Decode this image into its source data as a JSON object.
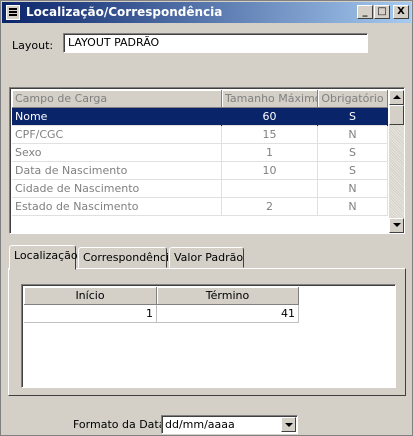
{
  "window": {
    "title": "Localização/Correspondência",
    "minimize": "_",
    "maximize": "□",
    "close": "X"
  },
  "layout": {
    "label": "Layout:",
    "value": "LAYOUT PADRÃO"
  },
  "grid": {
    "columns": [
      "Campo de Carga",
      "Tamanho Máximo",
      "Obrigatório"
    ],
    "rows": [
      {
        "campo": "Nome",
        "tamanho": "60",
        "obrigatorio": "S"
      },
      {
        "campo": "CPF/CGC",
        "tamanho": "15",
        "obrigatorio": "N"
      },
      {
        "campo": "Sexo",
        "tamanho": "1",
        "obrigatorio": "S"
      },
      {
        "campo": "Data de Nascimento",
        "tamanho": "10",
        "obrigatorio": "S"
      },
      {
        "campo": "Cidade de Nascimento",
        "tamanho": "",
        "obrigatorio": "N"
      },
      {
        "campo": "Estado de Nascimento",
        "tamanho": "2",
        "obrigatorio": "N"
      }
    ]
  },
  "tabs": [
    "Localização",
    "Correspondência",
    "Valor Padrão"
  ],
  "localizacao": {
    "columns": [
      "Início",
      "Término"
    ],
    "values": [
      "1",
      "41"
    ]
  },
  "formato": {
    "label": "Formato da Data:",
    "value": "dd/mm/aaaa"
  },
  "colors": {
    "title_start": "#0a246a",
    "title_end": "#a6caf0",
    "selection": "#0a246a",
    "face": "#d4d0c8"
  }
}
